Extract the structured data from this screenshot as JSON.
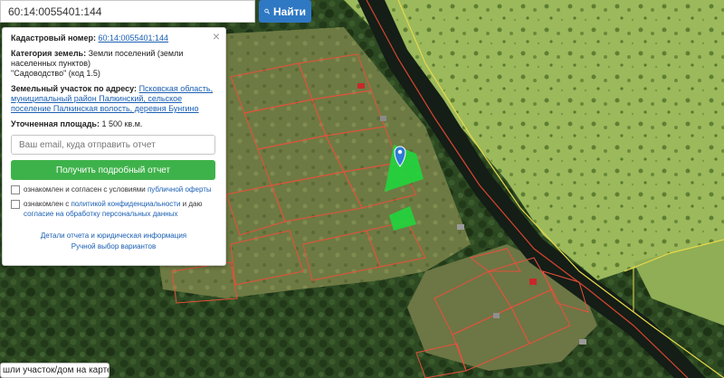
{
  "search": {
    "value": "60:14:0055401:144",
    "button_label": "Найти"
  },
  "panel": {
    "cadastral_label": "Кадастровый номер:",
    "cadastral_value": "60:14:0055401:144",
    "category_label": "Категория земель:",
    "category_value": "Земли поселений (земли населенных пунктов)",
    "usage_value": "\"Садоводство\" (код 1.5)",
    "address_label": "Земельный участок по адресу:",
    "address_value": "Псковская область, муниципальный район Палкинский, сельское поселение Палкинская волость, деревня Бунгино",
    "area_label": "Уточненная площадь:",
    "area_value": "1 500 кв.м.",
    "email_placeholder": "Ваш email, куда отправить отчет",
    "report_button": "Получить подробный отчет",
    "consent1_text": "ознакомлен и согласен с условиями",
    "consent1_link": "публичной оферты",
    "consent2_text": "ознакомлен с",
    "consent2_link": "политикой конфиденциальности",
    "consent2_mid": "и даю",
    "consent2_link2": "согласие на обработку персональных данных",
    "details_link": "Детали отчета и юридическая информация",
    "manual_link": "Ручной выбор вариантов"
  },
  "help": {
    "text": "шли участок/дом на карте?"
  },
  "colors": {
    "search_button": "#2f78c4",
    "report_button": "#3eb24a",
    "parcel_outline": "#e8503c",
    "selected_parcel": "#1fd63c",
    "river": "#141d16",
    "field": "#9cba5c"
  }
}
